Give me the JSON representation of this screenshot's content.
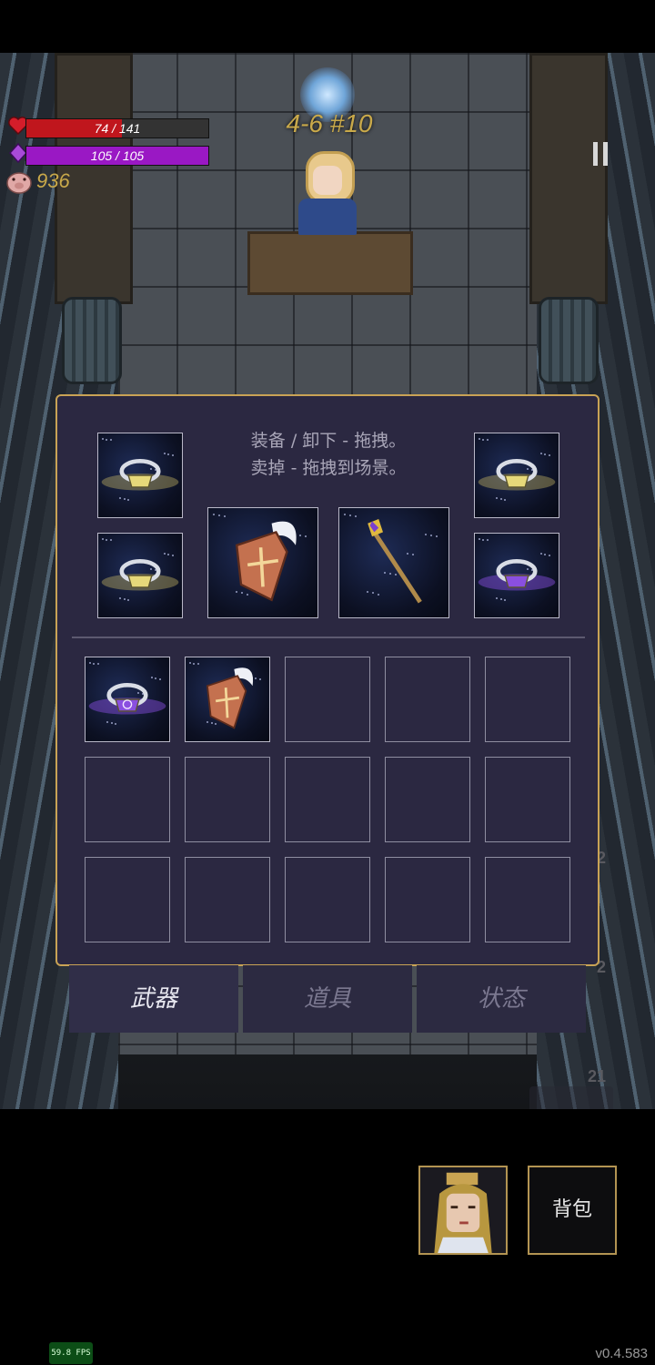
{
  "hud": {
    "hp": {
      "current": 74,
      "max": 141,
      "text": "74 / 141",
      "color": "#c0161d"
    },
    "mp": {
      "current": 105,
      "max": 105,
      "text": "105 / 105",
      "color": "#9a18c4"
    },
    "gold": "936",
    "level": "4-6 #10"
  },
  "inventory": {
    "hint_line1": "装备 / 卸下 - 拖拽。",
    "hint_line2": "卖掉 - 拖拽到场景。",
    "equipped": [
      {
        "slot": "ring-top-left",
        "item": "gold-ring-icon"
      },
      {
        "slot": "ring-bottom-left",
        "item": "gold-ring-icon"
      },
      {
        "slot": "offhand",
        "item": "winged-shield-icon"
      },
      {
        "slot": "weapon",
        "item": "magic-staff-icon"
      },
      {
        "slot": "ring-top-right",
        "item": "gold-ring-icon"
      },
      {
        "slot": "ring-bottom-right",
        "item": "purple-ring-icon"
      }
    ],
    "bag": [
      {
        "item": "purple-flower-ring-icon"
      },
      {
        "item": "winged-shield-icon"
      },
      {
        "item": ""
      },
      {
        "item": ""
      },
      {
        "item": ""
      },
      {
        "item": ""
      },
      {
        "item": ""
      },
      {
        "item": ""
      },
      {
        "item": ""
      },
      {
        "item": ""
      },
      {
        "item": ""
      },
      {
        "item": ""
      },
      {
        "item": ""
      },
      {
        "item": ""
      },
      {
        "item": ""
      }
    ]
  },
  "tabs": [
    {
      "label": "武器",
      "active": true
    },
    {
      "label": "道具",
      "active": false
    },
    {
      "label": "状态",
      "active": false
    }
  ],
  "bottom": {
    "bag_label": "背包",
    "fps": "59.8 FPS",
    "version": "v0.4.583"
  },
  "background_numbers": [
    "2",
    "2",
    "21"
  ],
  "colors": {
    "panel": "#2b2841",
    "panel_border": "#c9a355",
    "gold_text": "#c9a94a"
  }
}
